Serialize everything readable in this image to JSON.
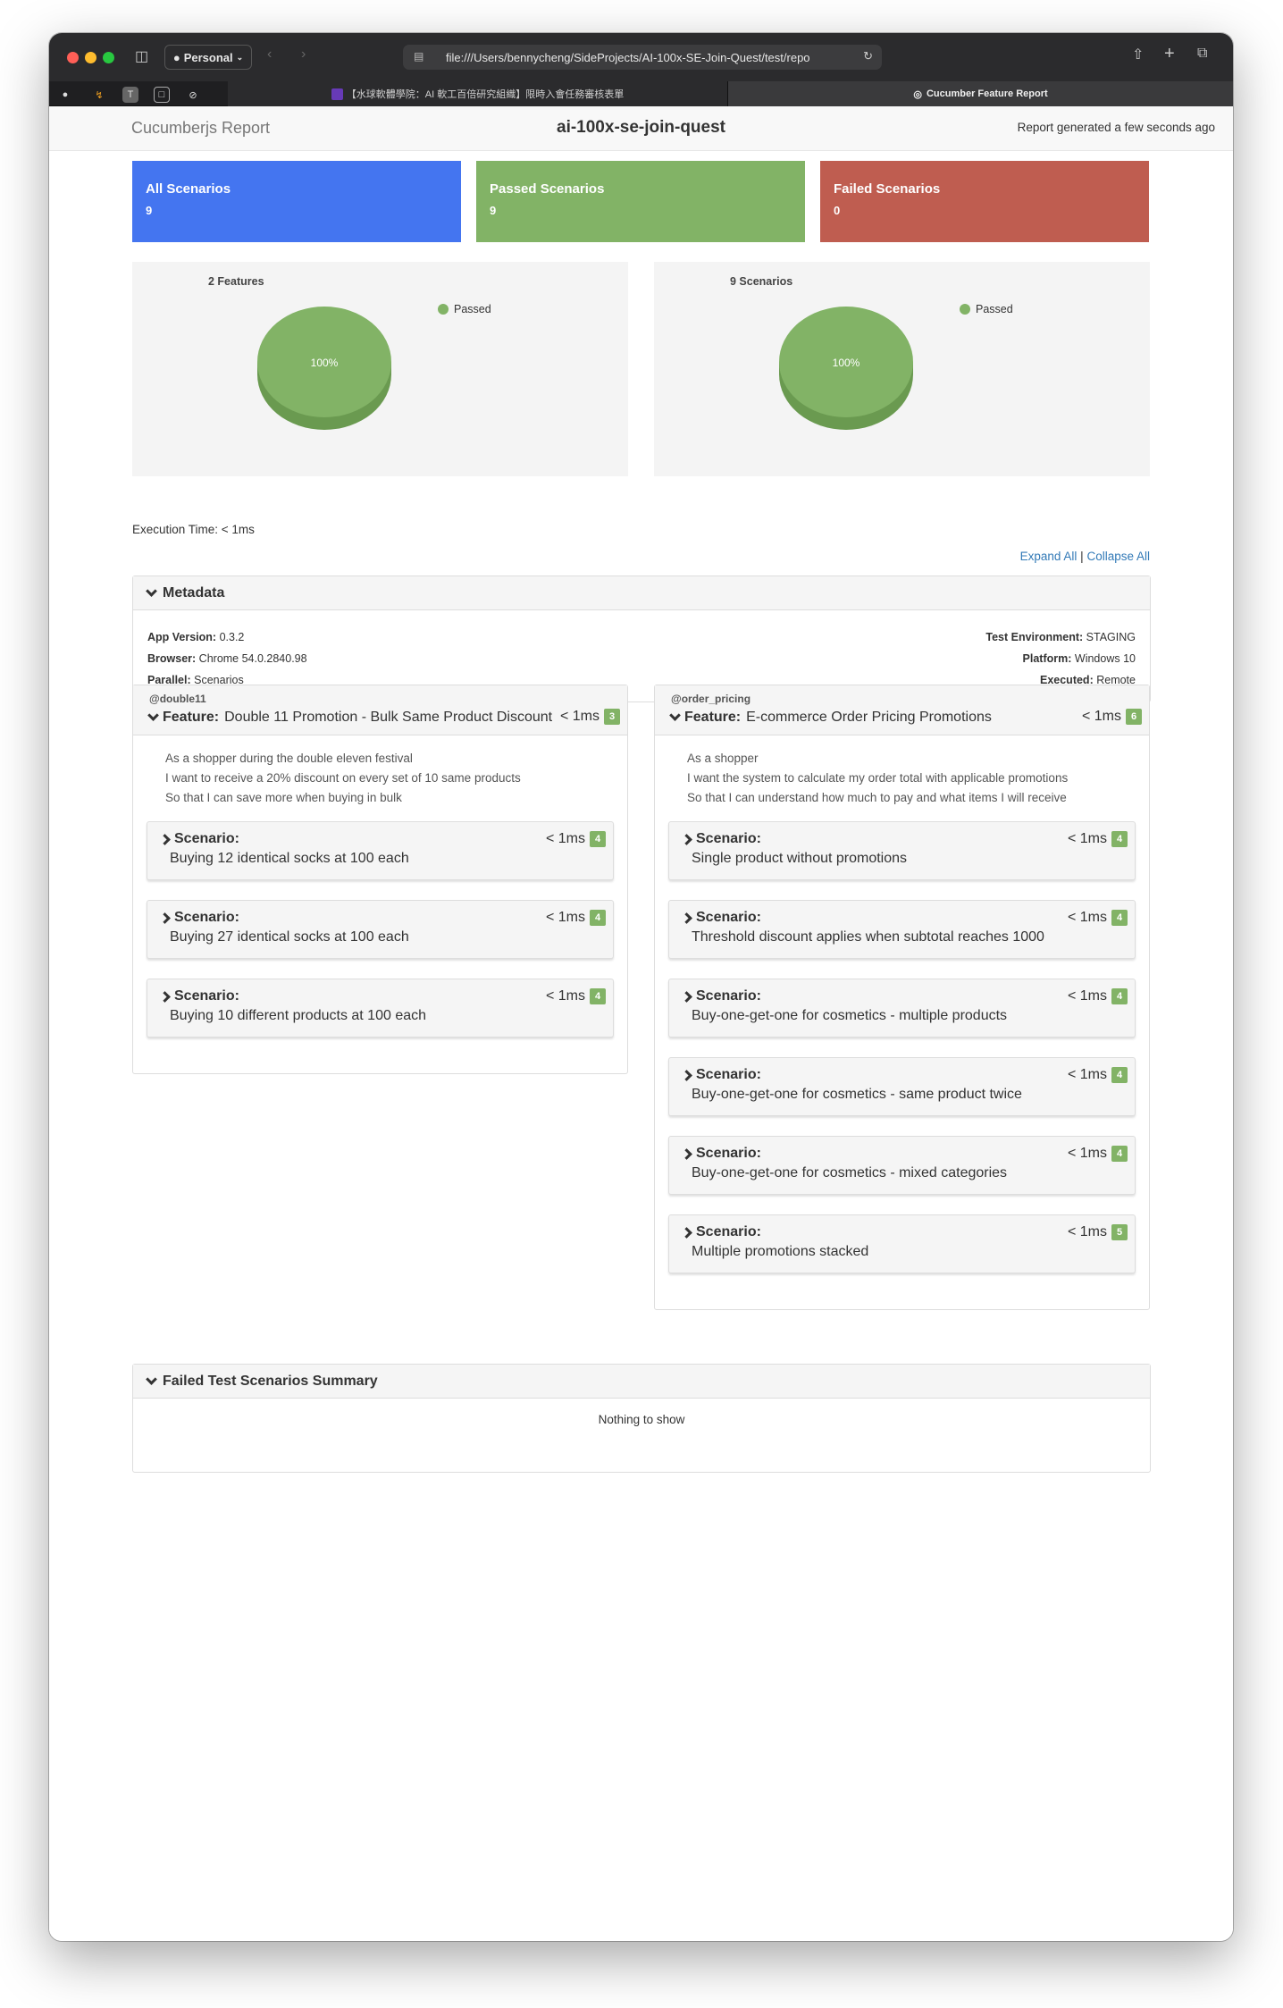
{
  "browser": {
    "profile": "Personal",
    "url": "file:///Users/bennycheng/SideProjects/AI-100x-SE-Join-Quest/test/repo",
    "tabs": [
      {
        "label": "【水球軟體學院：AI 軟工百倍研究組織】限時入會任務審核表單"
      },
      {
        "label": "Cucumber Feature Report"
      }
    ]
  },
  "report": {
    "brand": "Cucumberjs Report",
    "title": "ai-100x-se-join-quest",
    "generated": "Report generated a few seconds ago"
  },
  "tiles": {
    "all": {
      "label": "All Scenarios",
      "value": "9"
    },
    "passed": {
      "label": "Passed Scenarios",
      "value": "9"
    },
    "failed": {
      "label": "Failed Scenarios",
      "value": "0"
    }
  },
  "chart_data": [
    {
      "type": "pie",
      "title": "2 Features",
      "categories": [
        "Passed"
      ],
      "values": [
        100
      ],
      "labels": [
        "100%"
      ],
      "legend": "top-right",
      "colors": [
        "#82b366"
      ]
    },
    {
      "type": "pie",
      "title": "9 Scenarios",
      "categories": [
        "Passed"
      ],
      "values": [
        100
      ],
      "labels": [
        "100%"
      ],
      "legend": "top-right",
      "colors": [
        "#82b366"
      ]
    }
  ],
  "execution_time": "Execution Time: < 1ms",
  "controls": {
    "expand_all": "Expand All",
    "separator": "|",
    "collapse_all": "Collapse All"
  },
  "metadata": {
    "title": "Metadata",
    "app_version_label": "App Version:",
    "app_version": "0.3.2",
    "browser_label": "Browser:",
    "browser": "Chrome 54.0.2840.98",
    "parallel_label": "Parallel:",
    "parallel": "Scenarios",
    "test_env_label": "Test Environment:",
    "test_env": "STAGING",
    "platform_label": "Platform:",
    "platform": "Windows 10",
    "executed_label": "Executed:",
    "executed": "Remote"
  },
  "features": [
    {
      "tag": "@double11",
      "keyword": "Feature:",
      "name": "Double 11 Promotion - Bulk Same Product Discount",
      "duration": "< 1ms",
      "count": "3",
      "description": [
        "As a shopper during the double eleven festival",
        "I want to receive a 20% discount on every set of 10 same products",
        "So that I can save more when buying in bulk"
      ],
      "scenarios": [
        {
          "keyword": "Scenario:",
          "name": "Buying 12 identical socks at 100 each",
          "duration": "< 1ms",
          "count": "4"
        },
        {
          "keyword": "Scenario:",
          "name": "Buying 27 identical socks at 100 each",
          "duration": "< 1ms",
          "count": "4"
        },
        {
          "keyword": "Scenario:",
          "name": "Buying 10 different products at 100 each",
          "duration": "< 1ms",
          "count": "4"
        }
      ]
    },
    {
      "tag": "@order_pricing",
      "keyword": "Feature:",
      "name": "E-commerce Order Pricing Promotions",
      "duration": "< 1ms",
      "count": "6",
      "description": [
        "As a shopper",
        "I want the system to calculate my order total with applicable promotions",
        "So that I can understand how much to pay and what items I will receive"
      ],
      "scenarios": [
        {
          "keyword": "Scenario:",
          "name": "Single product without promotions",
          "duration": "< 1ms",
          "count": "4"
        },
        {
          "keyword": "Scenario:",
          "name": "Threshold discount applies when subtotal reaches 1000",
          "duration": "< 1ms",
          "count": "4"
        },
        {
          "keyword": "Scenario:",
          "name": "Buy-one-get-one for cosmetics - multiple products",
          "duration": "< 1ms",
          "count": "4"
        },
        {
          "keyword": "Scenario:",
          "name": "Buy-one-get-one for cosmetics - same product twice",
          "duration": "< 1ms",
          "count": "4"
        },
        {
          "keyword": "Scenario:",
          "name": "Buy-one-get-one for cosmetics - mixed categories",
          "duration": "< 1ms",
          "count": "4"
        },
        {
          "keyword": "Scenario:",
          "name": "Multiple promotions stacked",
          "duration": "< 1ms",
          "count": "5"
        }
      ]
    }
  ],
  "failed_summary": {
    "title": "Failed Test Scenarios Summary",
    "empty_text": "Nothing to show"
  }
}
